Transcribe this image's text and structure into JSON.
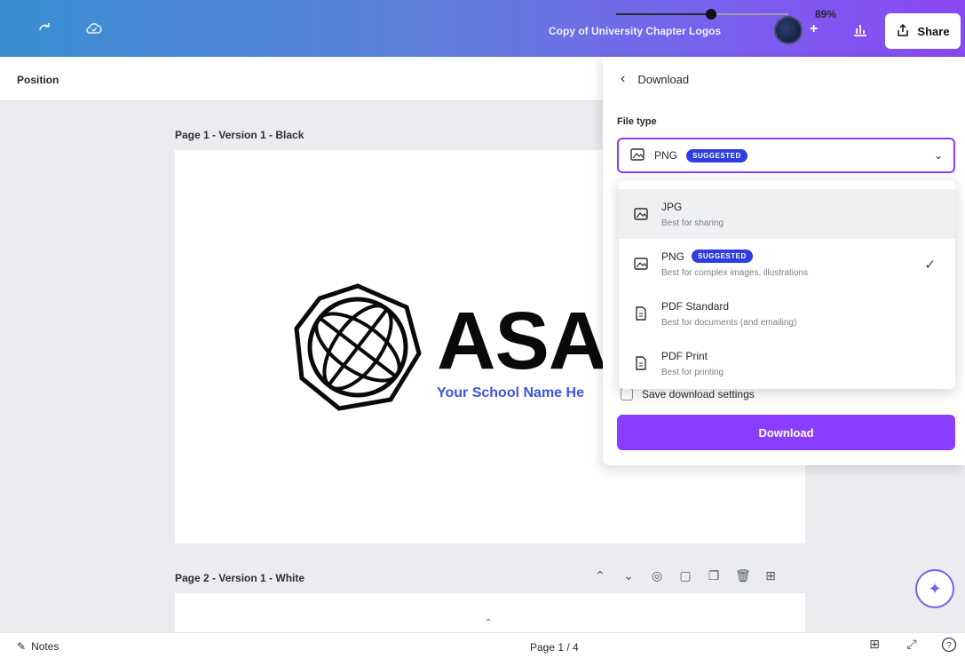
{
  "topbar": {
    "doc_title": "Copy of University Chapter Logos",
    "share_label": "Share"
  },
  "position_label": "Position",
  "canvas": {
    "page1_label": "Page 1 - Version 1 - Black",
    "page2_label": "Page 2 - Version 1 - White",
    "logo_text": "ASAI",
    "school_text": "Your School Name He"
  },
  "download_panel": {
    "title": "Download",
    "file_type_label": "File type",
    "selected_type": "PNG",
    "suggested_badge": "SUGGESTED",
    "options": [
      {
        "title": "JPG",
        "desc": "Best for sharing"
      },
      {
        "title": "PNG",
        "desc": "Best for complex images, illustrations",
        "badge": "SUGGESTED"
      },
      {
        "title": "PDF Standard",
        "desc": "Best for documents (and emailing)"
      },
      {
        "title": "PDF Print",
        "desc": "Best for printing"
      }
    ],
    "save_settings_label": "Save download settings",
    "download_button": "Download"
  },
  "bottombar": {
    "notes_label": "Notes",
    "page_info": "Page 1 / 4",
    "zoom": "89%",
    "zoom_fraction": 0.55
  },
  "colors": {
    "accent": "#8b3dff",
    "badge": "#2d3ee0",
    "school_text": "#3d55e0"
  }
}
